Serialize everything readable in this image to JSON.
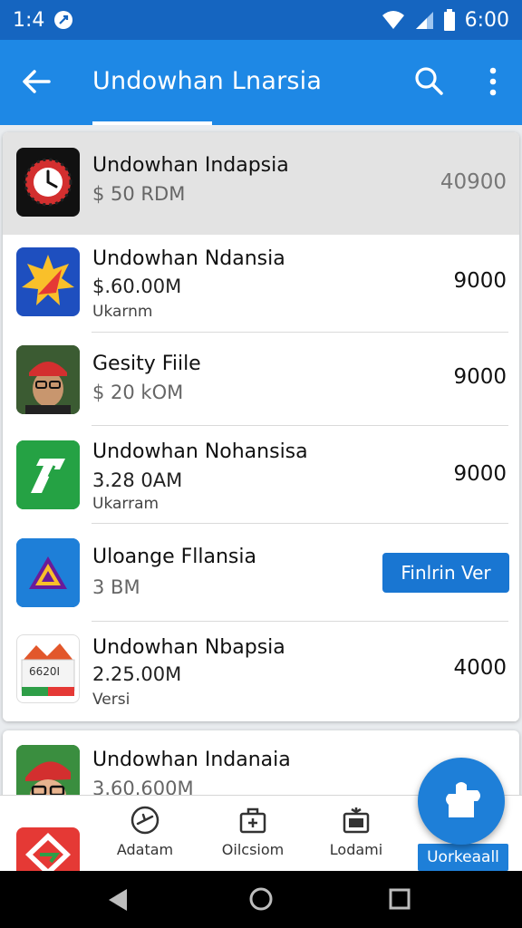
{
  "status_bar": {
    "time_left": "1:4",
    "time_right": "6:00"
  },
  "app_bar": {
    "title": "Undowhan Lnarsia"
  },
  "list": {
    "rows": [
      {
        "title": "Undowhan Indapsia",
        "subtitle": "$ 50 RDM",
        "value": "40900"
      },
      {
        "title": "Undowhan  Ndansia",
        "subtitle": "$.60.00M",
        "extra": "Ukarnm",
        "value": "9000"
      },
      {
        "title": "Gesity Fiile",
        "subtitle": "$ 20 kOM",
        "value": "9000"
      },
      {
        "title": "Undowhan Nohansisa",
        "subtitle": "3.28 0AM",
        "extra": "Ukarram",
        "value": "9000"
      },
      {
        "title": "Uloange Fllansia",
        "subtitle": "3 BM",
        "button": "Finlrin Ver"
      },
      {
        "title": "Undowhan Nbapsia",
        "subtitle": "2.25.00M",
        "extra": "Versi",
        "value": "4000",
        "icon_text": "6620I"
      }
    ]
  },
  "second_card": {
    "title": "Undowhan Indanaia",
    "subtitle": "3.60.600M"
  },
  "bottom_nav": {
    "items": [
      {
        "label": "Adatam"
      },
      {
        "label": "Oilcsiom"
      },
      {
        "label": "Lodami"
      }
    ],
    "badge": "Uorkeaall"
  },
  "icons": {
    "back": "arrow-left-icon",
    "search": "search-icon",
    "more": "more-vert-icon",
    "fab": "puzzle-icon"
  },
  "colors": {
    "app_bar": "#1e88e5",
    "status_bar": "#1565c0",
    "accent": "#1976d2"
  }
}
